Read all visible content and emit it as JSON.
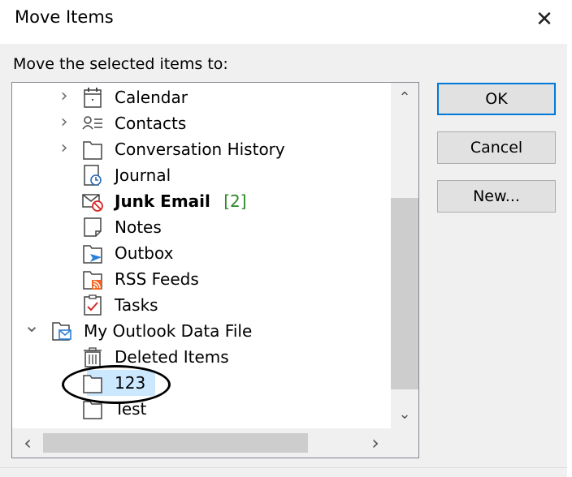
{
  "dialog": {
    "title": "Move Items",
    "close_glyph": "✕",
    "prompt": "Move the selected items to:"
  },
  "tree": {
    "selected_index": 11,
    "items": [
      {
        "label": "Calendar",
        "icon": "calendar-icon",
        "expander": "›",
        "bold": false,
        "count": ""
      },
      {
        "label": "Contacts",
        "icon": "contacts-icon",
        "expander": "›",
        "bold": false,
        "count": ""
      },
      {
        "label": "Conversation History",
        "icon": "folder-icon",
        "expander": "›",
        "bold": false,
        "count": ""
      },
      {
        "label": "Journal",
        "icon": "journal-icon",
        "expander": "",
        "bold": false,
        "count": ""
      },
      {
        "label": "Junk Email",
        "icon": "junk-email-icon",
        "expander": "",
        "bold": true,
        "count": "[2]"
      },
      {
        "label": "Notes",
        "icon": "notes-icon",
        "expander": "",
        "bold": false,
        "count": ""
      },
      {
        "label": "Outbox",
        "icon": "outbox-icon",
        "expander": "",
        "bold": false,
        "count": ""
      },
      {
        "label": "RSS Feeds",
        "icon": "rss-feeds-icon",
        "expander": "",
        "bold": false,
        "count": ""
      },
      {
        "label": "Tasks",
        "icon": "tasks-icon",
        "expander": "",
        "bold": false,
        "count": ""
      },
      {
        "label": "My Outlook Data File",
        "icon": "data-file-icon",
        "expander": "⌄",
        "bold": false,
        "count": ""
      },
      {
        "label": "Deleted Items",
        "icon": "trash-icon",
        "expander": "",
        "bold": false,
        "count": ""
      },
      {
        "label": "123",
        "icon": "folder-icon",
        "expander": "",
        "bold": false,
        "count": ""
      },
      {
        "label": "Test",
        "icon": "folder-icon",
        "expander": "",
        "bold": false,
        "count": ""
      }
    ]
  },
  "scrollbar": {
    "up_glyph": "⌃",
    "down_glyph": "⌄",
    "left_glyph": "‹",
    "right_glyph": "›"
  },
  "buttons": {
    "ok": "OK",
    "cancel": "Cancel",
    "new": "New..."
  },
  "colors": {
    "default_button_border": "#0078d7",
    "selection": "#cce8ff",
    "unread_count": "#2a8a2a"
  }
}
